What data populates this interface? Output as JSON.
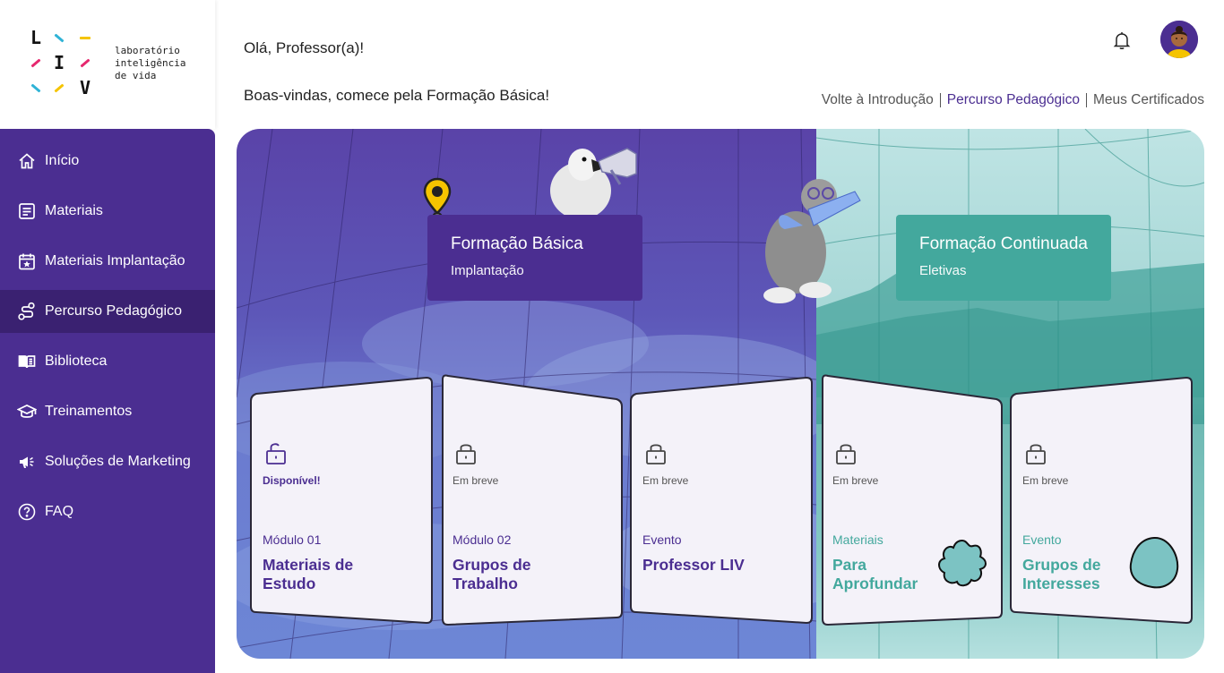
{
  "logo": {
    "letters": [
      "L",
      "I",
      "V"
    ],
    "text_lines": [
      "laboratório",
      "inteligência",
      "de vida"
    ]
  },
  "sidebar": {
    "items": [
      {
        "label": "Início",
        "icon": "home-icon"
      },
      {
        "label": "Materiais",
        "icon": "document-icon"
      },
      {
        "label": "Materiais Implantação",
        "icon": "calendar-star-icon"
      },
      {
        "label": "Percurso Pedagógico",
        "icon": "route-icon",
        "active": true
      },
      {
        "label": "Biblioteca",
        "icon": "book-icon"
      },
      {
        "label": "Treinamentos",
        "icon": "graduation-cap-icon"
      },
      {
        "label": "Soluções de Marketing",
        "icon": "megaphone-icon"
      },
      {
        "label": "FAQ",
        "icon": "question-icon"
      }
    ]
  },
  "header": {
    "greeting": "Olá, Professor(a)!",
    "subtitle": "Boas-vindas, comece pela Formação Básica!",
    "links": [
      "Volte à Introdução",
      "Percurso Pedagógico",
      "Meus Certificados"
    ],
    "active_link": "Percurso Pedagógico"
  },
  "banners": {
    "basic": {
      "title": "Formação Básica",
      "subtitle": "Implantação",
      "color": "#4b2e91"
    },
    "continued": {
      "title": "Formação Continuada",
      "subtitle": "Eletivas",
      "color": "#43a89d"
    }
  },
  "cards": [
    {
      "status": "Disponível!",
      "kicker": "Módulo 01",
      "title": "Materiais de Estudo",
      "theme": "purple",
      "available": true
    },
    {
      "status": "Em breve",
      "kicker": "Módulo 02",
      "title": "Grupos de Trabalho",
      "theme": "purple",
      "available": false
    },
    {
      "status": "Em breve",
      "kicker": "Evento",
      "title": "Professor LIV",
      "theme": "purple",
      "available": false
    },
    {
      "status": "Em breve",
      "kicker": "Materiais",
      "title": "Para Aprofundar",
      "theme": "teal",
      "available": false
    },
    {
      "status": "Em breve",
      "kicker": "Evento",
      "title": "Grupos de Interesses",
      "theme": "teal",
      "available": false
    }
  ],
  "colors": {
    "primary": "#4b2e91",
    "primary_dark": "#3a2171",
    "teal": "#43a89d",
    "pin": "#f5c400"
  }
}
